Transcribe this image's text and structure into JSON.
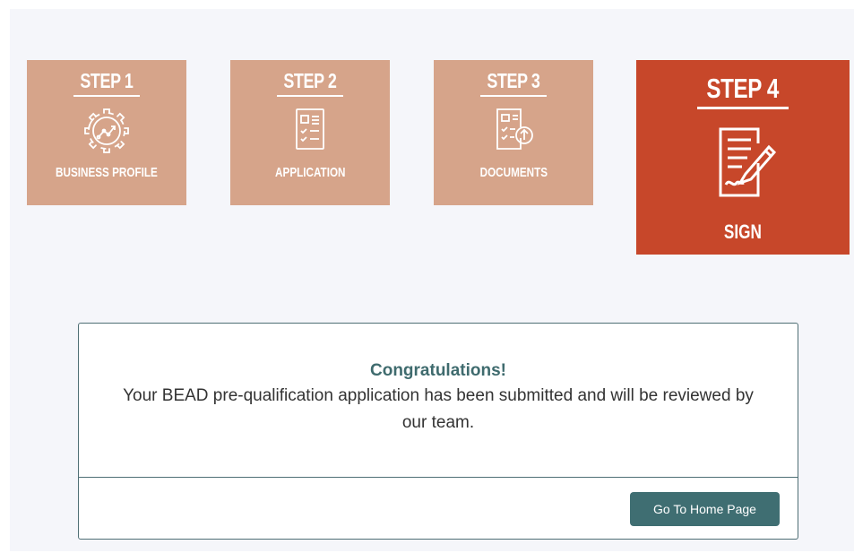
{
  "steps": [
    {
      "title": "STEP 1",
      "label": "BUSINESS PROFILE",
      "icon": "gear-chart-icon",
      "active": false
    },
    {
      "title": "STEP 2",
      "label": "APPLICATION",
      "icon": "checklist-icon",
      "active": false
    },
    {
      "title": "STEP 3",
      "label": "DOCUMENTS",
      "icon": "document-upload-icon",
      "active": false
    },
    {
      "title": "STEP 4",
      "label": "SIGN",
      "icon": "document-sign-icon",
      "active": true
    }
  ],
  "colors": {
    "step_inactive": "#d6a48a",
    "step_active": "#c7472a",
    "accent": "#3f6e72"
  },
  "card": {
    "heading": "Congratulations!",
    "message": "Your BEAD pre-qualification application has been submitted and will be reviewed by our team.",
    "button_label": "Go To Home Page"
  }
}
